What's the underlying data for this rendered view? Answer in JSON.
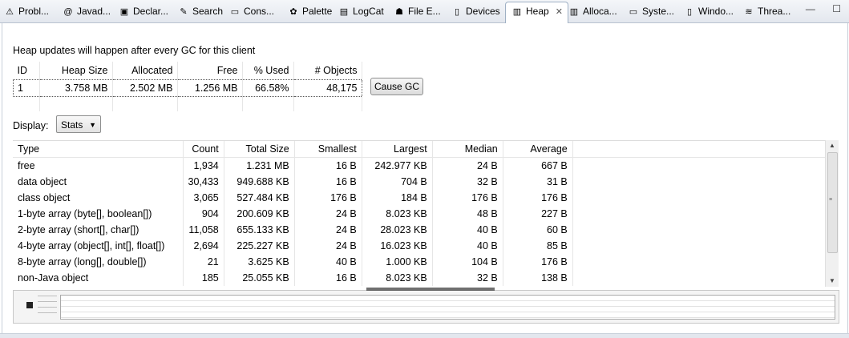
{
  "tabs": [
    {
      "label": "Probl...",
      "icon": "problems-icon",
      "glyph": "⚠"
    },
    {
      "label": "Javad...",
      "icon": "javadoc-icon",
      "glyph": "@"
    },
    {
      "label": "Declar...",
      "icon": "declaration-icon",
      "glyph": "▣"
    },
    {
      "label": "Search",
      "icon": "search-icon",
      "glyph": "✎"
    },
    {
      "label": "Cons...",
      "icon": "console-icon",
      "glyph": "▭"
    },
    {
      "label": "Palette",
      "icon": "palette-icon",
      "glyph": "✿"
    },
    {
      "label": "LogCat",
      "icon": "logcat-icon",
      "glyph": "▤"
    },
    {
      "label": "File E...",
      "icon": "android-icon",
      "glyph": "☗"
    },
    {
      "label": "Devices",
      "icon": "device-icon",
      "glyph": "▯"
    },
    {
      "label": "Heap",
      "icon": "heap-icon",
      "glyph": "▥",
      "active": true
    },
    {
      "label": "Alloca...",
      "icon": "allocation-icon",
      "glyph": "▥"
    },
    {
      "label": "Syste...",
      "icon": "system-icon",
      "glyph": "▭"
    },
    {
      "label": "Windo...",
      "icon": "window-icon",
      "glyph": "▯"
    },
    {
      "label": "Threa...",
      "icon": "threads-icon",
      "glyph": "≋"
    }
  ],
  "window_controls": {
    "minimize": "—",
    "maximize": "☐"
  },
  "notice": "Heap updates will happen after every GC for this client",
  "summary": {
    "headers": [
      "ID",
      "Heap Size",
      "Allocated",
      "Free",
      "% Used",
      "# Objects"
    ],
    "rows": [
      [
        "1",
        "3.758 MB",
        "2.502 MB",
        "1.256 MB",
        "66.58%",
        "48,175"
      ]
    ]
  },
  "cause_gc_label": "Cause GC",
  "display": {
    "label": "Display:",
    "value": "Stats"
  },
  "stats": {
    "headers": [
      "Type",
      "Count",
      "Total Size",
      "Smallest",
      "Largest",
      "Median",
      "Average"
    ],
    "rows": [
      [
        "free",
        "1,934",
        "1.231 MB",
        "16 B",
        "242.977 KB",
        "24 B",
        "667 B"
      ],
      [
        "data object",
        "30,433",
        "949.688 KB",
        "16 B",
        "704 B",
        "32 B",
        "31 B"
      ],
      [
        "class object",
        "3,065",
        "527.484 KB",
        "176 B",
        "184 B",
        "176 B",
        "176 B"
      ],
      [
        "1-byte array (byte[], boolean[])",
        "904",
        "200.609 KB",
        "24 B",
        "8.023 KB",
        "48 B",
        "227 B"
      ],
      [
        "2-byte array (short[], char[])",
        "11,058",
        "655.133 KB",
        "24 B",
        "28.023 KB",
        "40 B",
        "60 B"
      ],
      [
        "4-byte array (object[], int[], float[])",
        "2,694",
        "225.227 KB",
        "24 B",
        "16.023 KB",
        "40 B",
        "85 B"
      ],
      [
        "8-byte array (long[], double[])",
        "21",
        "3.625 KB",
        "40 B",
        "1.000 KB",
        "104 B",
        "176 B"
      ],
      [
        "non-Java object",
        "185",
        "25.055 KB",
        "16 B",
        "8.023 KB",
        "32 B",
        "138 B"
      ]
    ]
  },
  "colors": {
    "tabbar_top": "#f4f6f9",
    "tabbar_bottom": "#e3e7ee",
    "border": "#c8d0da"
  }
}
